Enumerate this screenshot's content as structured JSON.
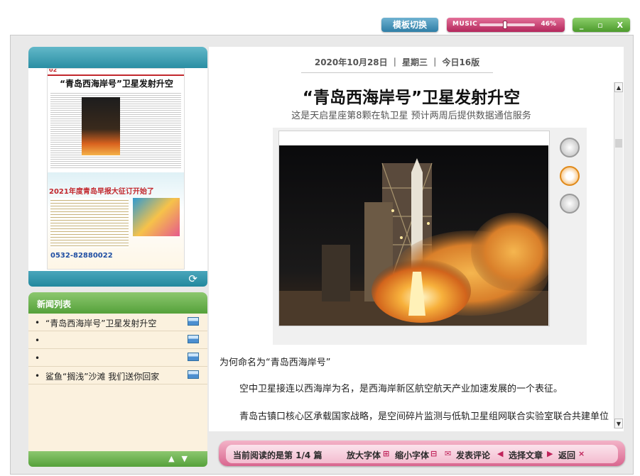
{
  "top_controls": {
    "template_switch": "模板切换",
    "music_label": "MUSIC",
    "music_volume": 0.46,
    "music_percent": "46%",
    "window_buttons": [
      "_",
      "▫",
      "X"
    ]
  },
  "date_bar": {
    "date": "2020年10月28日",
    "weekday": "星期三",
    "edition": "今日16版"
  },
  "news_list": {
    "title": "新闻列表",
    "items": [
      {
        "label": "“青岛西海岸号”卫星发射升空"
      },
      {
        "label": ""
      },
      {
        "label": ""
      },
      {
        "label": "鲨鱼“搁浅”沙滩 我们送你回家"
      }
    ]
  },
  "thumbnail": {
    "page_label": "02",
    "headline": "“青岛西海岸号”卫星发射升空",
    "ad_title": "2021年度青岛早报大征订开始了",
    "phone": "0532-82880022"
  },
  "article": {
    "title": "“青岛西海岸号”卫星发射升空",
    "subtitle": "这是天启星座第8颗在轨卫星 预计两周后提供数据通信服务",
    "caption": "为何命名为“青岛西海岸号”",
    "paragraphs": [
      "空中卫星接连以西海岸为名，是西海岸新区航空航天产业加速发展的一个表征。",
      "青岛古镇口核心区承载国家战略，是空间碎片监测与低轨卫星组网联合实验室联合共建单位之一，为实验室建设提供科技研发、资源支撑、产业承载综合平台支撑。在云芯仁"
    ]
  },
  "toolbar": {
    "current": "当前阅读的是第 1/4 篇",
    "zoom_in": "放大字体",
    "zoom_out": "缩小字体",
    "comment": "发表评论",
    "select_article": "选择文章",
    "back": "返回"
  }
}
